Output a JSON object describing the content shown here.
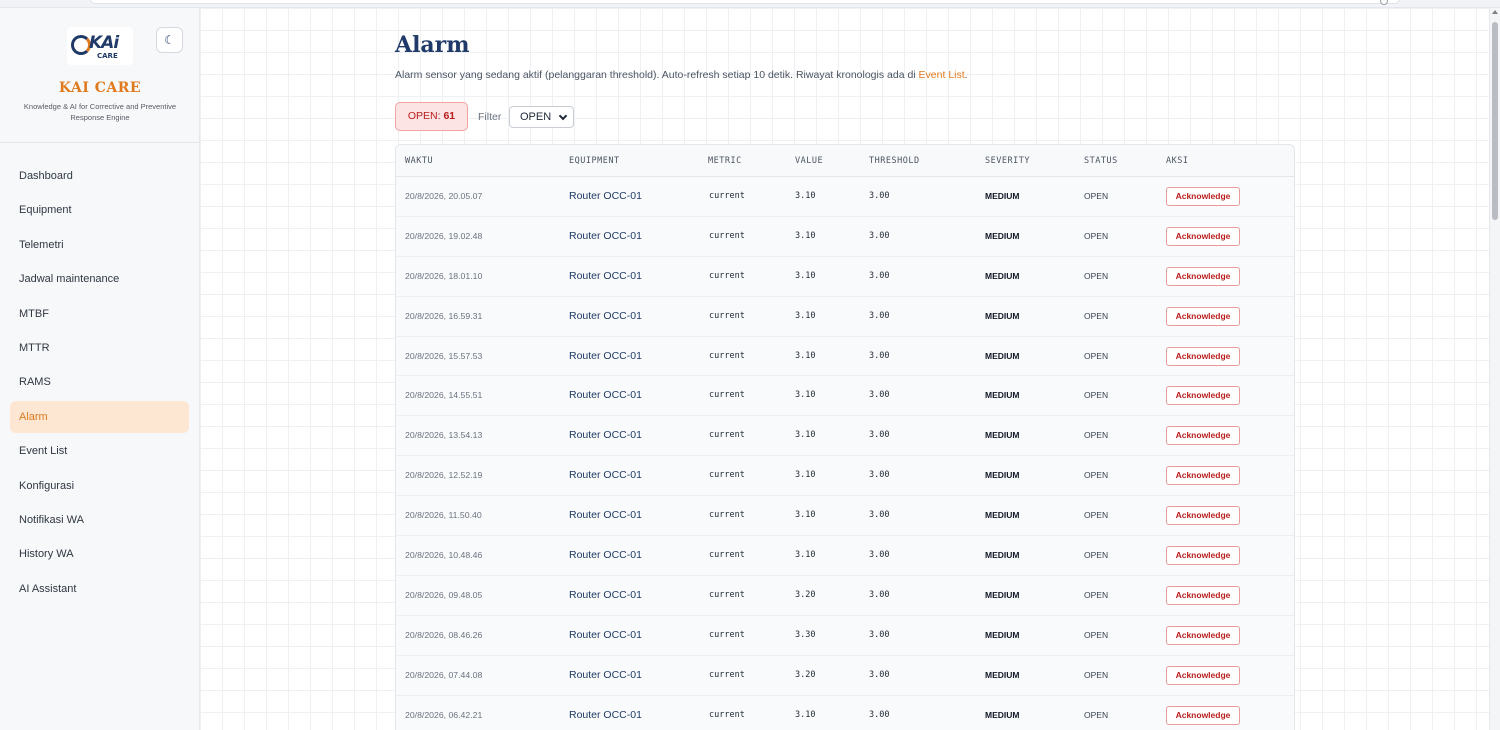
{
  "brand": {
    "title": "KAI CARE",
    "subtitle": "Knowledge & AI for Corrective and Preventive Response Engine",
    "logo_text": "KAi",
    "logo_subtext": "CARE"
  },
  "sidebar": {
    "items": [
      {
        "label": "Dashboard",
        "active": false
      },
      {
        "label": "Equipment",
        "active": false
      },
      {
        "label": "Telemetri",
        "active": false
      },
      {
        "label": "Jadwal maintenance",
        "active": false
      },
      {
        "label": "MTBF",
        "active": false
      },
      {
        "label": "MTTR",
        "active": false
      },
      {
        "label": "RAMS",
        "active": false
      },
      {
        "label": "Alarm",
        "active": true
      },
      {
        "label": "Event List",
        "active": false
      },
      {
        "label": "Konfigurasi",
        "active": false
      },
      {
        "label": "Notifikasi WA",
        "active": false
      },
      {
        "label": "History WA",
        "active": false
      },
      {
        "label": "AI Assistant",
        "active": false
      }
    ]
  },
  "page": {
    "title": "Alarm",
    "description": "Alarm sensor yang sedang aktif (pelanggaran threshold). Auto-refresh setiap 10 detik. Riwayat kronologis ada di ",
    "description_link": "Event List",
    "description_end": "."
  },
  "summary": {
    "open_label": "OPEN: ",
    "open_count": "61"
  },
  "filter": {
    "label": "Filter",
    "selected": "OPEN"
  },
  "table": {
    "headers": [
      "WAKTU",
      "EQUIPMENT",
      "METRIC",
      "VALUE",
      "THRESHOLD",
      "SEVERITY",
      "STATUS",
      "AKSI"
    ],
    "action_label": "Acknowledge",
    "rows": [
      {
        "time": "20/8/2026, 20.05.07",
        "equipment": "Router OCC-01",
        "metric": "current",
        "value": "3.10",
        "threshold": "3.00",
        "severity": "MEDIUM",
        "status": "OPEN"
      },
      {
        "time": "20/8/2026, 19.02.48",
        "equipment": "Router OCC-01",
        "metric": "current",
        "value": "3.10",
        "threshold": "3.00",
        "severity": "MEDIUM",
        "status": "OPEN"
      },
      {
        "time": "20/8/2026, 18.01.10",
        "equipment": "Router OCC-01",
        "metric": "current",
        "value": "3.10",
        "threshold": "3.00",
        "severity": "MEDIUM",
        "status": "OPEN"
      },
      {
        "time": "20/8/2026, 16.59.31",
        "equipment": "Router OCC-01",
        "metric": "current",
        "value": "3.10",
        "threshold": "3.00",
        "severity": "MEDIUM",
        "status": "OPEN"
      },
      {
        "time": "20/8/2026, 15.57.53",
        "equipment": "Router OCC-01",
        "metric": "current",
        "value": "3.10",
        "threshold": "3.00",
        "severity": "MEDIUM",
        "status": "OPEN"
      },
      {
        "time": "20/8/2026, 14.55.51",
        "equipment": "Router OCC-01",
        "metric": "current",
        "value": "3.10",
        "threshold": "3.00",
        "severity": "MEDIUM",
        "status": "OPEN"
      },
      {
        "time": "20/8/2026, 13.54.13",
        "equipment": "Router OCC-01",
        "metric": "current",
        "value": "3.10",
        "threshold": "3.00",
        "severity": "MEDIUM",
        "status": "OPEN"
      },
      {
        "time": "20/8/2026, 12.52.19",
        "equipment": "Router OCC-01",
        "metric": "current",
        "value": "3.10",
        "threshold": "3.00",
        "severity": "MEDIUM",
        "status": "OPEN"
      },
      {
        "time": "20/8/2026, 11.50.40",
        "equipment": "Router OCC-01",
        "metric": "current",
        "value": "3.10",
        "threshold": "3.00",
        "severity": "MEDIUM",
        "status": "OPEN"
      },
      {
        "time": "20/8/2026, 10.48.46",
        "equipment": "Router OCC-01",
        "metric": "current",
        "value": "3.10",
        "threshold": "3.00",
        "severity": "MEDIUM",
        "status": "OPEN"
      },
      {
        "time": "20/8/2026, 09.48.05",
        "equipment": "Router OCC-01",
        "metric": "current",
        "value": "3.20",
        "threshold": "3.00",
        "severity": "MEDIUM",
        "status": "OPEN"
      },
      {
        "time": "20/8/2026, 08.46.26",
        "equipment": "Router OCC-01",
        "metric": "current",
        "value": "3.30",
        "threshold": "3.00",
        "severity": "MEDIUM",
        "status": "OPEN"
      },
      {
        "time": "20/8/2026, 07.44.08",
        "equipment": "Router OCC-01",
        "metric": "current",
        "value": "3.20",
        "threshold": "3.00",
        "severity": "MEDIUM",
        "status": "OPEN"
      },
      {
        "time": "20/8/2026, 06.42.21",
        "equipment": "Router OCC-01",
        "metric": "current",
        "value": "3.10",
        "threshold": "3.00",
        "severity": "MEDIUM",
        "status": "OPEN"
      }
    ]
  },
  "colors": {
    "accent": "#e07a1f",
    "brand_navy": "#1f3a68",
    "open_badge_bg": "#fde4e4",
    "open_badge_text": "#b91c1c",
    "active_nav_bg": "#fde6d2"
  },
  "icons": {
    "theme_toggle": "moon-icon",
    "filter_dropdown": "chevron-down-icon"
  }
}
